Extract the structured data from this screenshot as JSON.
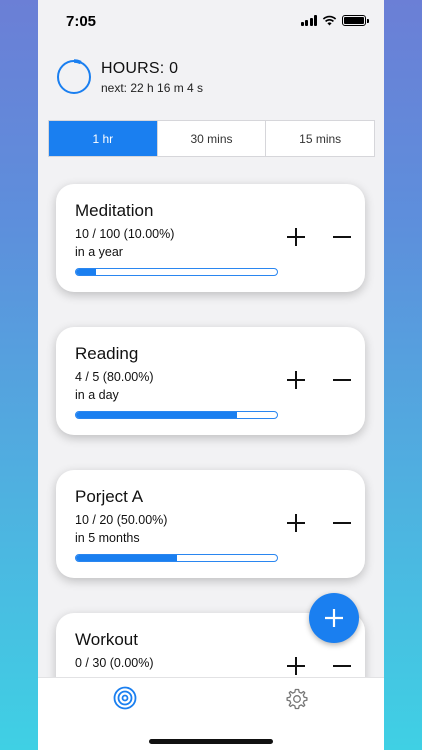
{
  "status_bar": {
    "time": "7:05"
  },
  "header": {
    "title": "HOURS: 0",
    "next": "next: 22 h 16 m 4 s",
    "ring_progress": 0.07
  },
  "segments": [
    {
      "label": "1 hr",
      "active": true
    },
    {
      "label": "30 mins",
      "active": false
    },
    {
      "label": "15 mins",
      "active": false
    }
  ],
  "cards": [
    {
      "title": "Meditation",
      "count": "10 / 100 (10.00%)",
      "period": "in a year",
      "progress": 0.1
    },
    {
      "title": "Reading",
      "count": "4 / 5 (80.00%)",
      "period": "in a day",
      "progress": 0.8
    },
    {
      "title": "Porject A",
      "count": "10 / 20 (50.00%)",
      "period": "in 5 months",
      "progress": 0.5
    },
    {
      "title": "Workout",
      "count": "0 / 30 (0.00%)",
      "period": "",
      "progress": 0.0
    }
  ],
  "colors": {
    "accent": "#1a7ff0",
    "card": "#ffffff",
    "background": "#f2f2f4"
  },
  "icons": {
    "plus": "plus-icon",
    "minus": "minus-icon",
    "fab": "plus-icon",
    "tab_home": "target-icon",
    "tab_settings": "gear-icon"
  }
}
